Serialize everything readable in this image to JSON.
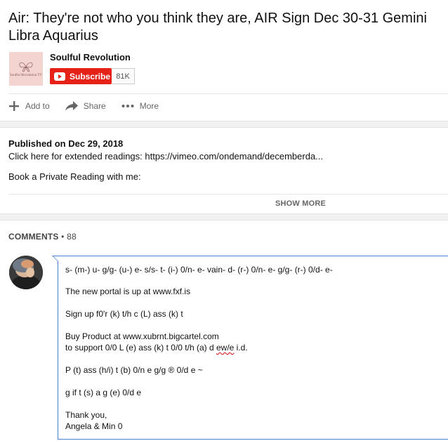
{
  "video": {
    "title": "Air: They're not who you think they are, AIR Sign Dec 30-31 Gemini Libra Aquarius"
  },
  "channel": {
    "name": "Soulful Revolution",
    "thumb_text": "Soulful Revolution TV",
    "subscribe_label": "Subscribe",
    "subscriber_count": "81K"
  },
  "actions": {
    "add_to": "Add to",
    "share": "Share",
    "more": "More"
  },
  "description": {
    "published": "Published on Dec 29, 2018",
    "line1": "Click here for extended readings: https://vimeo.com/ondemand/decemberda...",
    "line2": "Book a Private Reading with me:",
    "show_more": "SHOW MORE"
  },
  "comments": {
    "label": "COMMENTS",
    "count": "• 88",
    "draft": {
      "l1": "s- (m-) u- g/g- (u-) e- s/s- t- (i-) 0/n- e-  vain- d- (r-) 0/n- e- g/g- (r-) 0/d- e-",
      "l2": "The new portal is up at www.fxf.is",
      "l3": "Sign up f0'r (k) t/h c (L) ass (k) t",
      "l4": "Buy Product at www.xubrnt.bigcartel.com",
      "l5a": "to support 0/0 L (e) ass (k) t 0/0 t/h (a) d ",
      "l5b": "ew/e",
      "l5c": " i.d.",
      "l6": "P (t) ass (h/i) t (b) 0/n e g/g ® 0/d e ~",
      "l7": "g if t (s) a g (e) 0/d e",
      "l8": "Thank you,",
      "l9": "Angela & Min 0"
    }
  },
  "colors": {
    "subscribe": "#e62117",
    "focus_border": "#4a7fd6"
  }
}
